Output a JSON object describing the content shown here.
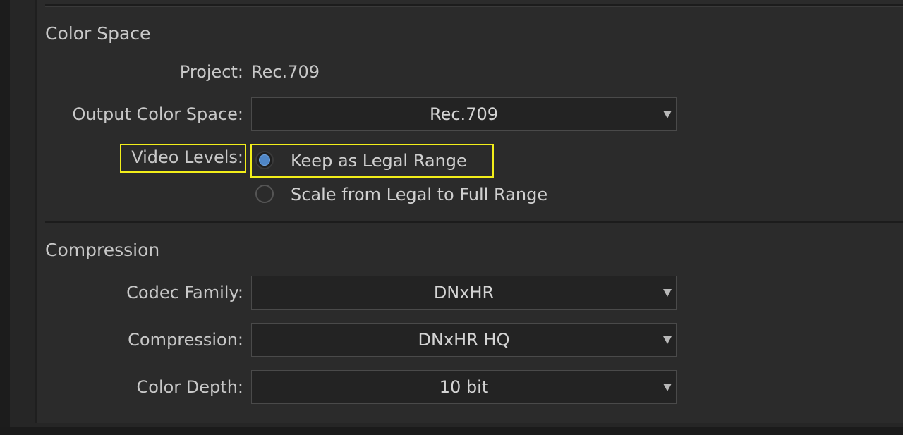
{
  "color_space": {
    "title": "Color Space",
    "project_label": "Project:",
    "project_value": "Rec.709",
    "output_label": "Output Color Space:",
    "output_value": "Rec.709",
    "video_levels_label": "Video Levels:",
    "options": [
      {
        "label": "Keep as Legal Range",
        "selected": true
      },
      {
        "label": "Scale from Legal to Full Range",
        "selected": false
      }
    ]
  },
  "compression": {
    "title": "Compression",
    "codec_family_label": "Codec Family:",
    "codec_family_value": "DNxHR",
    "compression_label": "Compression:",
    "compression_value": "DNxHR HQ",
    "color_depth_label": "Color Depth:",
    "color_depth_value": "10 bit"
  },
  "colors": {
    "highlight": "#f2ee1a",
    "radio_selected": "#4f86c6",
    "background": "#2b2b2b"
  },
  "icons": {
    "dropdown": "chevron-down-icon"
  }
}
